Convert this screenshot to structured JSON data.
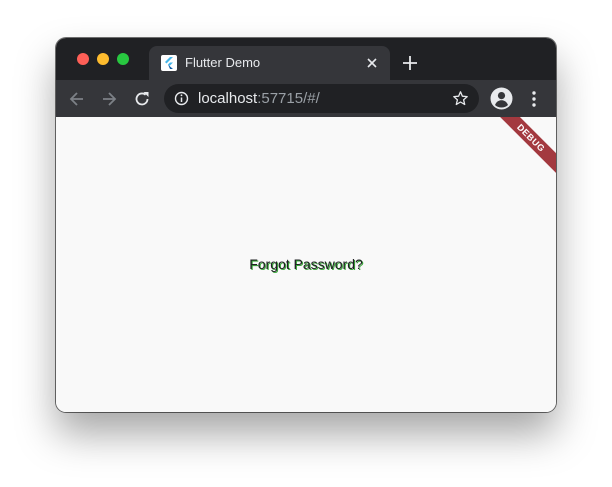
{
  "browser": {
    "tab": {
      "title": "Flutter Demo",
      "favicon": "flutter-logo-icon"
    },
    "address_bar": {
      "host": "localhost",
      "rest": ":57715/#/"
    },
    "icons": {
      "back": "arrow-left-icon",
      "forward": "arrow-right-icon",
      "reload": "reload-icon",
      "info": "info-icon",
      "star": "star-icon",
      "profile": "profile-icon",
      "menu": "kebab-menu-icon",
      "new_tab": "plus-icon",
      "close_tab": "close-icon"
    },
    "colors": {
      "chrome_dark": "#202124",
      "tab_active": "#35363a",
      "traffic_red": "#fe5f57",
      "traffic_yellow": "#febc2e",
      "traffic_green": "#28c840"
    }
  },
  "page": {
    "link_text": "Forgot Password?",
    "debug_banner": "DEBUG",
    "colors": {
      "background": "#f9f9f9",
      "text": "#202124",
      "text_shadow": "#3aa83a",
      "banner": "#a3393f"
    }
  }
}
